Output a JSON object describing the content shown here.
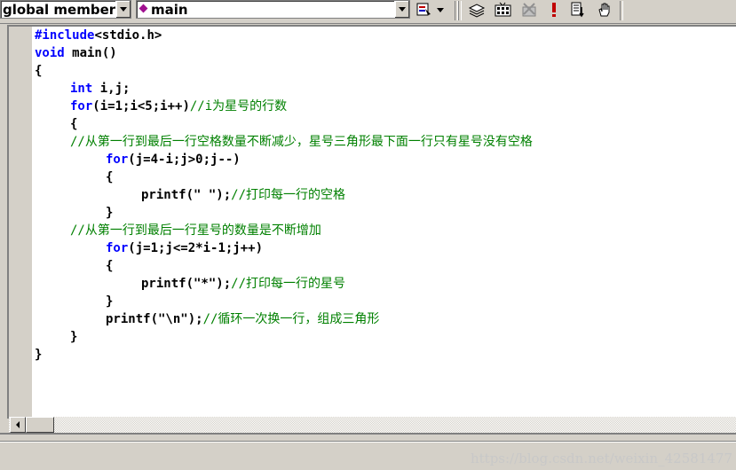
{
  "toolbar": {
    "scope_combo": {
      "value": "global members"
    },
    "function_combo": {
      "value": "main"
    },
    "icons": [
      "wizard-bar-icon",
      "compile-icon",
      "build-icon",
      "stop-build-icon",
      "execute-icon",
      "go-icon",
      "breakpoint-icon"
    ],
    "colors": {
      "stop": "#c00000",
      "execute": "#c00000",
      "diamond": "#a01090"
    }
  },
  "code": {
    "lines": [
      {
        "segments": [
          {
            "t": "#include",
            "k": "kw"
          },
          {
            "t": "<stdio.h>",
            "k": ""
          }
        ],
        "indent": 0
      },
      {
        "segments": [
          {
            "t": "void",
            "k": "kw"
          },
          {
            "t": " main()",
            "k": ""
          }
        ],
        "indent": 0
      },
      {
        "segments": [
          {
            "t": "{",
            "k": ""
          }
        ],
        "indent": 0
      },
      {
        "segments": [
          {
            "t": "int",
            "k": "kw"
          },
          {
            "t": " i,j;",
            "k": ""
          }
        ],
        "indent": 1
      },
      {
        "segments": [
          {
            "t": "for",
            "k": "kw"
          },
          {
            "t": "(i=1;i<5;i++)",
            "k": ""
          },
          {
            "t": "//i为星号的行数",
            "k": "cm"
          }
        ],
        "indent": 1
      },
      {
        "segments": [
          {
            "t": "{",
            "k": ""
          }
        ],
        "indent": 1
      },
      {
        "segments": [
          {
            "t": "//从第一行到最后一行空格数量不断减少，星号三角形最下面一行只有星号没有空格",
            "k": "cm"
          }
        ],
        "indent": 1
      },
      {
        "segments": [
          {
            "t": "for",
            "k": "kw"
          },
          {
            "t": "(j=4-i;j>0;j--)",
            "k": ""
          }
        ],
        "indent": 2
      },
      {
        "segments": [
          {
            "t": "{",
            "k": ""
          }
        ],
        "indent": 2
      },
      {
        "segments": [
          {
            "t": "printf(\" \");",
            "k": ""
          },
          {
            "t": "//打印每一行的空格",
            "k": "cm"
          }
        ],
        "indent": 3
      },
      {
        "segments": [
          {
            "t": "}",
            "k": ""
          }
        ],
        "indent": 2
      },
      {
        "segments": [
          {
            "t": "//从第一行到最后一行星号的数量是不断增加",
            "k": "cm"
          }
        ],
        "indent": 1
      },
      {
        "segments": [
          {
            "t": "for",
            "k": "kw"
          },
          {
            "t": "(j=1;j<=2*i-1;j++)",
            "k": ""
          }
        ],
        "indent": 2
      },
      {
        "segments": [
          {
            "t": "{",
            "k": ""
          }
        ],
        "indent": 2
      },
      {
        "segments": [
          {
            "t": "printf(\"*\");",
            "k": ""
          },
          {
            "t": "//打印每一行的星号",
            "k": "cm"
          }
        ],
        "indent": 3
      },
      {
        "segments": [
          {
            "t": "}",
            "k": ""
          }
        ],
        "indent": 2
      },
      {
        "segments": [
          {
            "t": "printf(\"\\n\");",
            "k": ""
          },
          {
            "t": "//循环一次换一行，组成三角形",
            "k": "cm"
          }
        ],
        "indent": 2
      },
      {
        "segments": [
          {
            "t": "}",
            "k": ""
          }
        ],
        "indent": 1
      },
      {
        "segments": [
          {
            "t": "}",
            "k": ""
          }
        ],
        "indent": 0
      }
    ],
    "colors": {
      "keyword": "#0000ff",
      "comment": "#008000",
      "text": "#000000"
    }
  },
  "watermark": "https://blog.csdn.net/weixin_42581477"
}
